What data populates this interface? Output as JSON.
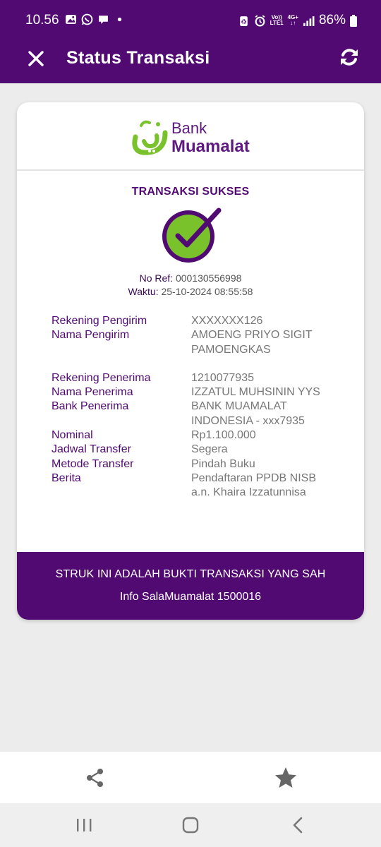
{
  "status_bar": {
    "time": "10.56",
    "battery": "86%",
    "network": "4G+",
    "volte_top": "Vo))",
    "volte_bottom": "LTE1"
  },
  "app_bar": {
    "title": "Status Transaksi"
  },
  "logo": {
    "line1": "Bank",
    "line2": "Muamalat"
  },
  "transaction": {
    "status": "TRANSAKSI SUKSES",
    "ref_label": "No Ref:",
    "ref_value": "000130556998",
    "time_label": "Waktu:",
    "time_value": "25-10-2024 08:55:58"
  },
  "details": {
    "sender_account_label": "Rekening Pengirim",
    "sender_account_value": "XXXXXXX126",
    "sender_name_label": "Nama Pengirim",
    "sender_name_line1": "AMOENG PRIYO SIGIT",
    "sender_name_line2": "PAMOENGKAS",
    "receiver_account_label": "Rekening Penerima",
    "receiver_account_value": "1210077935",
    "receiver_name_label": "Nama Penerima",
    "receiver_name_value": "IZZATUL MUHSININ YYS",
    "receiver_bank_label": "Bank Penerima",
    "receiver_bank_line1": "BANK MUAMALAT",
    "receiver_bank_line2": "INDONESIA - xxx7935",
    "amount_label": "Nominal",
    "amount_value": "Rp1.100.000",
    "schedule_label": "Jadwal Transfer",
    "schedule_value": "Segera",
    "method_label": "Metode Transfer",
    "method_value": "Pindah Buku",
    "note_label": "Berita",
    "note_line1": "Pendaftaran PPDB NISB",
    "note_line2": "a.n. Khaira Izzatunnisa"
  },
  "footer": {
    "line1": "STRUK INI ADALAH BUKTI TRANSAKSI YANG SAH",
    "line2": "Info SalaMuamalat 1500016"
  },
  "colors": {
    "brand_purple": "#520a73",
    "success_green": "#7ac22c"
  },
  "icons": {
    "close": "close-icon",
    "refresh": "refresh-icon",
    "check": "check-circle-icon",
    "share": "share-icon",
    "star": "star-icon"
  }
}
